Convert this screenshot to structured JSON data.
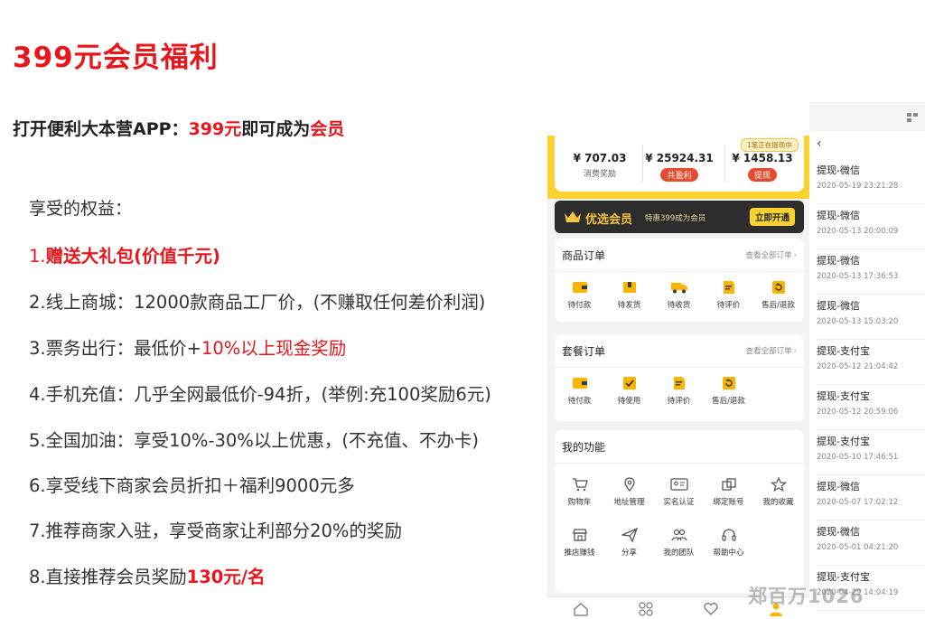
{
  "slide": {
    "title": "399元会员福利",
    "intro_prefix": "打开便利大本营APP：",
    "intro_price": "399元",
    "intro_mid": "即可成为",
    "intro_member": "会员",
    "benefits_heading": "享受的权益：",
    "benefits": [
      {
        "num": "1.",
        "text": "",
        "highlight": "赠送大礼包(价值千元)",
        "tail": ""
      },
      {
        "num": "2.",
        "text": "线上商城：12000款商品工厂价，(不赚取任何差价利润)",
        "highlight": "",
        "tail": ""
      },
      {
        "num": "3.",
        "text": "票务出行：最低价+",
        "highlight": "10%以上现金奖励",
        "tail": ""
      },
      {
        "num": "4.",
        "text": "手机充值：几乎全网最低价-94折，(举例:充100奖励6元)",
        "highlight": "",
        "tail": ""
      },
      {
        "num": "5.",
        "text": "全国加油：享受10%-30%以上优惠，(不充值、不办卡)",
        "highlight": "",
        "tail": ""
      },
      {
        "num": "6.",
        "text": "享受线下商家会员折扣＋福利9000元多",
        "highlight": "",
        "tail": ""
      },
      {
        "num": "7.",
        "text": "推荐商家入驻，享受商家让利部分20%的奖励",
        "highlight": "",
        "tail": ""
      },
      {
        "num": "8.",
        "text": "直接推荐会员奖励",
        "highlight": "130元/名",
        "tail": ""
      }
    ]
  },
  "phone": {
    "notice": "1笔正在提现中",
    "stats": [
      {
        "value": "¥ 707.03",
        "label": "消费奖励"
      },
      {
        "value": "¥ 25924.31",
        "label": "共盈利"
      },
      {
        "value": "¥ 1458.13",
        "label": "提现"
      }
    ],
    "vip": {
      "title": "优选会员",
      "desc": "特惠399成为会员",
      "button": "立即开通"
    },
    "orders": {
      "title": "商品订单",
      "more": "查看全部订单",
      "items": [
        {
          "label": "待付款",
          "icon": "wallet-icon"
        },
        {
          "label": "待发货",
          "icon": "box-icon"
        },
        {
          "label": "待收货",
          "icon": "truck-icon"
        },
        {
          "label": "待评价",
          "icon": "review-icon"
        },
        {
          "label": "售后/退款",
          "icon": "refund-icon"
        }
      ]
    },
    "packages": {
      "title": "套餐订单",
      "more": "查看全部订单",
      "items": [
        {
          "label": "待付款",
          "icon": "wallet-icon"
        },
        {
          "label": "待使用",
          "icon": "check-box-icon"
        },
        {
          "label": "待评价",
          "icon": "review-icon"
        },
        {
          "label": "售后/退款",
          "icon": "refund-icon"
        }
      ]
    },
    "functions": {
      "title": "我的功能",
      "items": [
        {
          "label": "购物车",
          "icon": "cart-icon"
        },
        {
          "label": "地址管理",
          "icon": "location-icon"
        },
        {
          "label": "实名认证",
          "icon": "id-card-icon"
        },
        {
          "label": "绑定账号",
          "icon": "link-account-icon"
        },
        {
          "label": "我的收藏",
          "icon": "star-icon"
        },
        {
          "label": "推店赚钱",
          "icon": "store-icon"
        },
        {
          "label": "分享",
          "icon": "share-icon"
        },
        {
          "label": "我的团队",
          "icon": "team-icon"
        },
        {
          "label": "帮助中心",
          "icon": "headset-icon"
        }
      ]
    }
  },
  "withdrawals": [
    {
      "title": "提现-微信",
      "date": "2020-05-19 23:21:28"
    },
    {
      "title": "提现-微信",
      "date": "2020-05-13 20:00:09"
    },
    {
      "title": "提现-微信",
      "date": "2020-05-13 17:36:53"
    },
    {
      "title": "提现-微信",
      "date": "2020-05-13 15:03:20"
    },
    {
      "title": "提现-支付宝",
      "date": "2020-05-12 21:04:42"
    },
    {
      "title": "提现-支付宝",
      "date": "2020-05-12 20:59:06"
    },
    {
      "title": "提现-支付宝",
      "date": "2020-05-10 17:46:51"
    },
    {
      "title": "提现-微信",
      "date": "2020-05-07 17:02:12"
    },
    {
      "title": "提现-微信",
      "date": "2020-05-01 04:21:20"
    },
    {
      "title": "提现-支付宝",
      "date": "2020-04-29 14:04:19"
    }
  ],
  "watermark": "郑百万1026",
  "colors": {
    "accent_red": "#e8161b",
    "brand_yellow": "#fbd230",
    "vip_dark": "#2d2d2d"
  }
}
